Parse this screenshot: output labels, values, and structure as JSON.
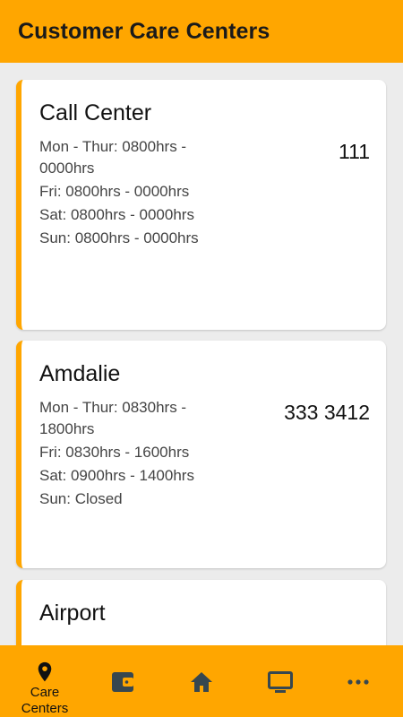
{
  "header": {
    "title": "Customer Care Centers"
  },
  "centers": [
    {
      "name": "Call Center",
      "phone": "111",
      "hours": [
        "Mon - Thur: 0800hrs - 0000hrs",
        "Fri: 0800hrs - 0000hrs",
        "Sat: 0800hrs - 0000hrs",
        "Sun: 0800hrs - 0000hrs"
      ]
    },
    {
      "name": "Amdalie",
      "phone": "333 3412",
      "hours": [
        "Mon - Thur: 0830hrs - 1800hrs",
        "Fri: 0830hrs - 1600hrs",
        "Sat: 0900hrs - 1400hrs",
        "Sun: Closed"
      ]
    },
    {
      "name": "Airport"
    }
  ],
  "nav": {
    "active_label": "Care Centers",
    "items": [
      "location-pin-icon",
      "wallet-icon",
      "home-icon",
      "monitor-icon",
      "more-icon"
    ]
  },
  "colors": {
    "accent": "#ffa600",
    "icon": "#37474f"
  }
}
